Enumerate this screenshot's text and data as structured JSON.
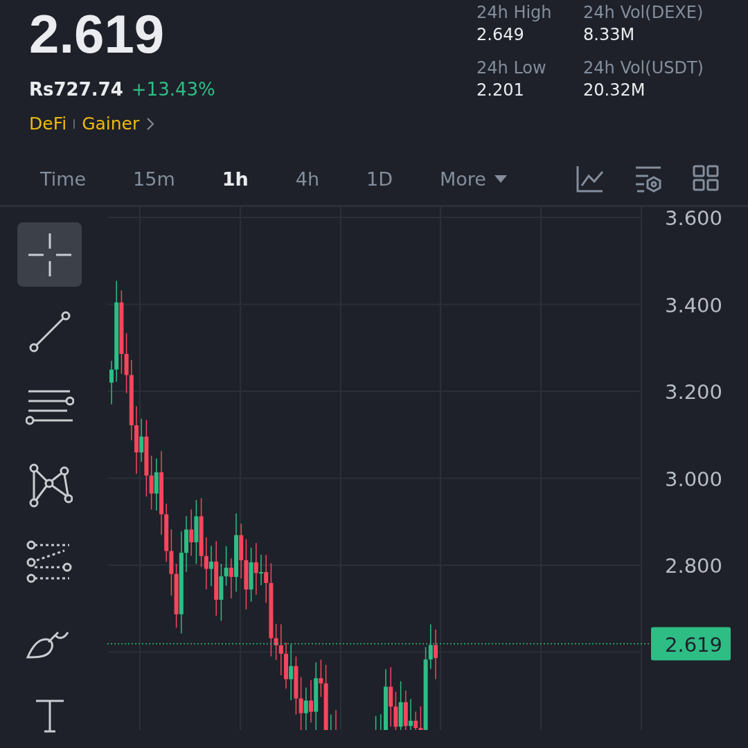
{
  "price": {
    "last": "2.619",
    "fiat": "Rs727.74",
    "change": "+13.43%"
  },
  "tags": [
    "DeFi",
    "Gainer"
  ],
  "stats": [
    {
      "label": "24h High",
      "value": "2.649"
    },
    {
      "label": "24h Vol(DEXE)",
      "value": "8.33M"
    },
    {
      "label": "24h Low",
      "value": "2.201"
    },
    {
      "label": "24h Vol(USDT)",
      "value": "20.32M"
    }
  ],
  "intervals": [
    {
      "label": "Time",
      "selected": false,
      "kind": "plain"
    },
    {
      "label": "15m",
      "selected": false,
      "kind": "plain"
    },
    {
      "label": "1h",
      "selected": true,
      "kind": "plain"
    },
    {
      "label": "4h",
      "selected": false,
      "kind": "plain"
    },
    {
      "label": "1D",
      "selected": false,
      "kind": "plain"
    },
    {
      "label": "More",
      "selected": false,
      "kind": "dropdown"
    }
  ],
  "tools": [
    {
      "selected": true
    },
    {
      "selected": false
    },
    {
      "selected": false
    },
    {
      "selected": false
    },
    {
      "selected": false
    },
    {
      "selected": false
    },
    {
      "selected": false
    }
  ],
  "chart": {
    "price_axis": [
      "3.600",
      "3.400",
      "3.200",
      "3.000",
      "2.800"
    ],
    "last_price_tag": "2.619"
  }
}
